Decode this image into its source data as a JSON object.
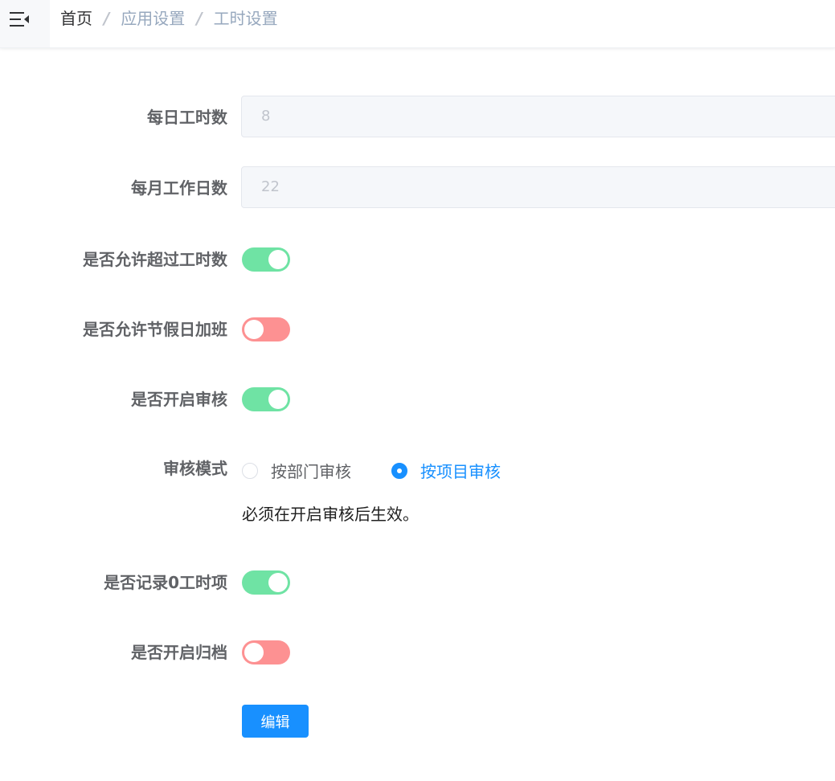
{
  "header": {
    "menu_icon": "hamburger-fold-icon",
    "breadcrumb": [
      "首页",
      "应用设置",
      "工时设置"
    ],
    "separator": "/"
  },
  "form": {
    "daily_hours": {
      "label": "每日工时数",
      "value": "8"
    },
    "monthly_workdays": {
      "label": "每月工作日数",
      "value": "22"
    },
    "allow_exceed_hours": {
      "label": "是否允许超过工时数",
      "state": "on"
    },
    "allow_holiday_overtime": {
      "label": "是否允许节假日加班",
      "state": "off"
    },
    "enable_review": {
      "label": "是否开启审核",
      "state": "on"
    },
    "review_mode": {
      "label": "审核模式",
      "options": [
        "按部门审核",
        "按项目审核"
      ],
      "selected": "按项目审核",
      "hint": "必须在开启审核后生效。"
    },
    "record_zero_hours": {
      "label": "是否记录0工时项",
      "state": "on"
    },
    "enable_archive": {
      "label": "是否开启归档",
      "state": "off"
    }
  },
  "edit_button": "编辑",
  "colors": {
    "switch_on": "#6fe3a4",
    "switch_off": "#fd9192",
    "primary": "#1890ff"
  }
}
